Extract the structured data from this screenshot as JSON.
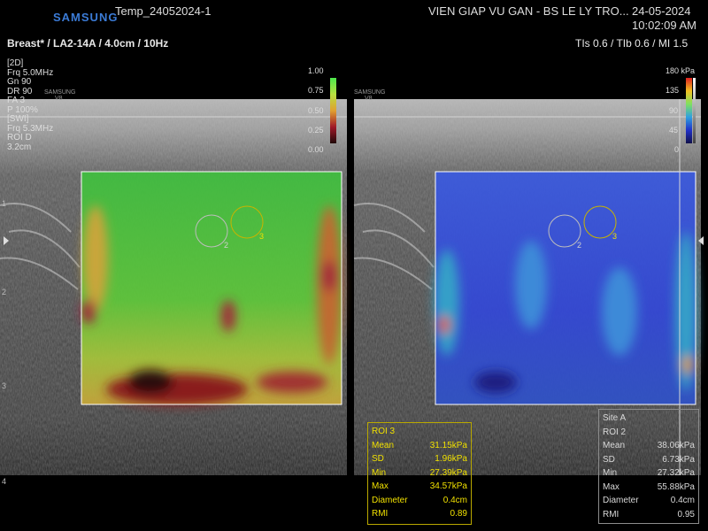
{
  "header": {
    "brand": "SAMSUNG",
    "patient_id": "Temp_24052024-1",
    "institution": "VIEN GIAP VU GAN - BS LE LY TRO...",
    "date": "24-05-2024",
    "time": "10:02:09 AM",
    "preset": "Breast* / LA2-14A / 4.0cm / 10Hz",
    "thermal": "TIs  0.6 / TIb  0.6 / MI    1.5"
  },
  "params": {
    "lines": [
      "[2D]",
      "Frq  5.0MHz",
      "Gn    90",
      "DR   90",
      "FA    3",
      "P     100%",
      "[SWI]",
      "Frq  5.3MHz",
      "ROI D",
      "      3.2cm"
    ]
  },
  "probe_logo": {
    "brand": "SAMSUNG",
    "model": "V8"
  },
  "scale_left": {
    "labels": [
      "1.00",
      "0.75",
      "0.50",
      "0.25",
      "0.00"
    ]
  },
  "scale_right": {
    "unit_top": "180 kPa",
    "labels": [
      "135",
      "90",
      "45",
      "0"
    ]
  },
  "roi_circles": {
    "a": "2",
    "b": "3"
  },
  "roi3": {
    "title": "ROI 3",
    "rows": [
      {
        "k": "Mean",
        "v": "31.15kPa"
      },
      {
        "k": "SD",
        "v": "1.96kPa"
      },
      {
        "k": "Min",
        "v": "27.39kPa"
      },
      {
        "k": "Max",
        "v": "34.57kPa"
      },
      {
        "k": "Diameter",
        "v": "0.4cm"
      },
      {
        "k": "RMI",
        "v": "0.89"
      }
    ]
  },
  "roi2": {
    "site": "Site A",
    "title": "ROI 2",
    "rows": [
      {
        "k": "Mean",
        "v": "38.06kPa"
      },
      {
        "k": "SD",
        "v": "6.73kPa"
      },
      {
        "k": "Min",
        "v": "27.32kPa"
      },
      {
        "k": "Max",
        "v": "55.88kPa"
      },
      {
        "k": "Diameter",
        "v": "0.4cm"
      },
      {
        "k": "RMI",
        "v": "0.95"
      }
    ]
  },
  "depth_marks": [
    "1",
    "2",
    "3",
    "4"
  ],
  "colors": {
    "roi3": "#f0e000",
    "roi_circle": "#c8b400",
    "box": "#ffffff",
    "brand": "#3b7bd6"
  }
}
